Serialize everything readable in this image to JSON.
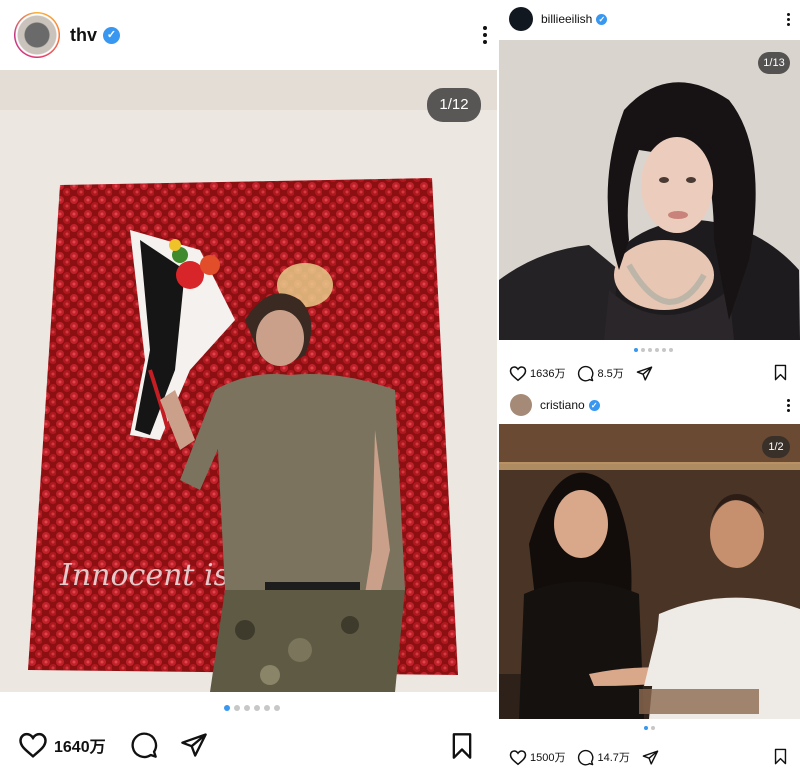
{
  "posts": [
    {
      "username": "thv",
      "verified": true,
      "counter": "1/12",
      "likes": "1640万",
      "dots": 6,
      "active_dot": 0,
      "photo_text": "Innocent is ... ty"
    },
    {
      "username": "billieeilish",
      "verified": true,
      "counter": "1/13",
      "likes": "1636万",
      "comments": "8.5万",
      "dots": 6,
      "active_dot": 0
    },
    {
      "username": "cristiano",
      "verified": true,
      "counter": "1/2",
      "likes": "1500万",
      "comments": "14.7万",
      "dots": 2,
      "active_dot": 0
    }
  ],
  "icons": {
    "like": "heart-outline-icon",
    "comment": "comment-bubble-icon",
    "share": "paper-plane-icon",
    "save": "bookmark-outline-icon",
    "more": "vertical-dots-icon",
    "verified": "verified-badge-icon"
  },
  "colors": {
    "verified_blue": "#3897f0",
    "active_dot": "#3897f0",
    "inactive_dot": "#c7c7c7"
  }
}
